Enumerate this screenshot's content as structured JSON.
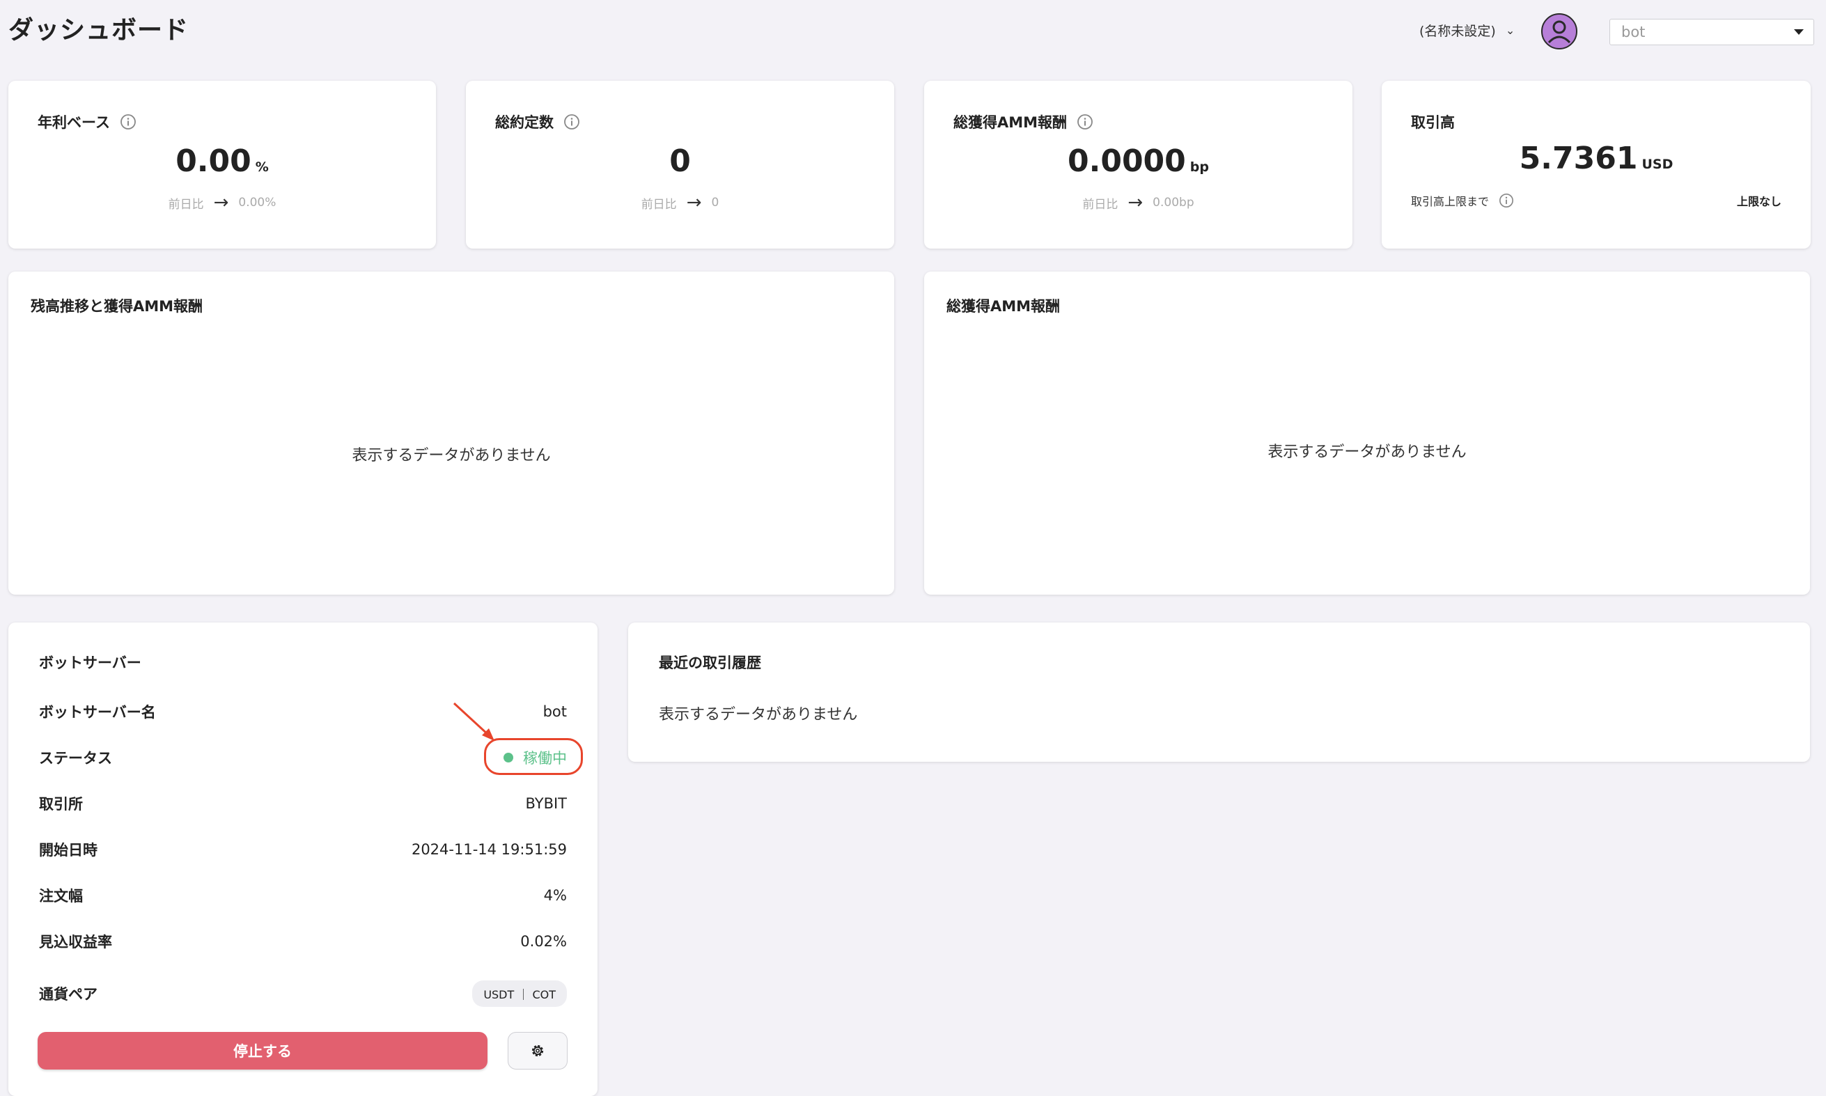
{
  "header": {
    "title": "ダッシュボード",
    "workspace": "(名称未設定)",
    "bot_select_value": "bot"
  },
  "kpis": [
    {
      "label": "年利ベース",
      "value": "0.00",
      "unit": "%",
      "compare_label": "前日比",
      "compare_value": "0.00%"
    },
    {
      "label": "総約定数",
      "value": "0",
      "unit": "",
      "compare_label": "前日比",
      "compare_value": "0"
    },
    {
      "label": "総獲得AMM報酬",
      "value": "0.0000",
      "unit": "bp",
      "compare_label": "前日比",
      "compare_value": "0.00bp"
    },
    {
      "label": "取引高",
      "value": "5.7361",
      "unit": "USD",
      "limit_label": "取引高上限まで",
      "limit_value": "上限なし"
    }
  ],
  "panels": {
    "balance": {
      "title": "残高推移と獲得AMM報酬",
      "empty": "表示するデータがありません"
    },
    "amm": {
      "title": "総獲得AMM報酬",
      "empty": "表示するデータがありません"
    },
    "history": {
      "title": "最近の取引履歴",
      "empty": "表示するデータがありません"
    }
  },
  "bot_server": {
    "title": "ボットサーバー",
    "rows": [
      {
        "key": "ボットサーバー名",
        "value": "bot"
      },
      {
        "key": "ステータス",
        "value": "稼働中"
      },
      {
        "key": "取引所",
        "value": "BYBIT"
      },
      {
        "key": "開始日時",
        "value": "2024-11-14 19:51:59"
      },
      {
        "key": "注文幅",
        "value": "4%"
      },
      {
        "key": "見込収益率",
        "value": "0.02%"
      },
      {
        "key": "通貨ペア",
        "value": "USDT ｜ COT"
      }
    ],
    "stop_label": "停止する"
  },
  "colors": {
    "status_green": "#5cc18a",
    "stop_red": "#e2606f",
    "annotation_red": "#e8452c",
    "avatar": "#b77fd8"
  },
  "icons": [
    "info-icon",
    "arrow-right-icon",
    "chevron-down-icon",
    "user-avatar-icon",
    "caret-down-icon",
    "gear-icon",
    "status-dot-icon"
  ]
}
